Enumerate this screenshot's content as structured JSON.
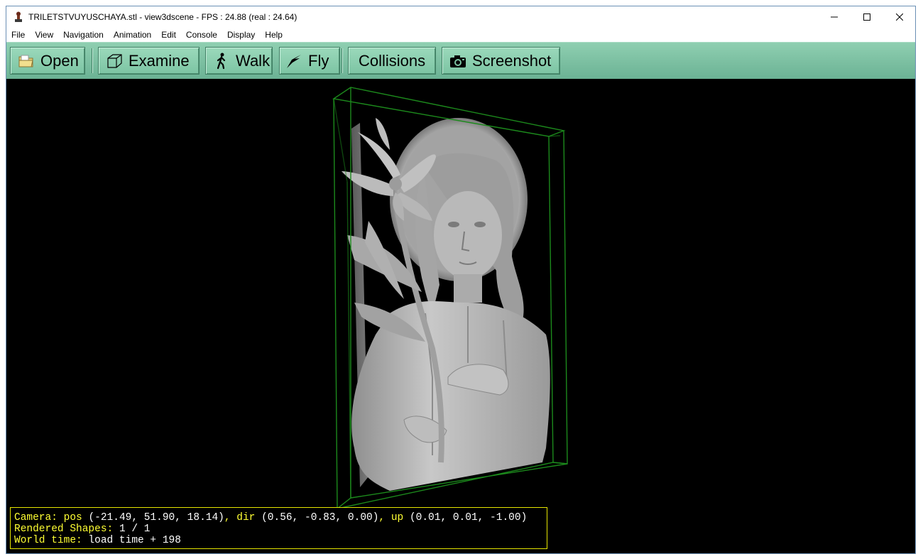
{
  "window": {
    "title": "TRILETSTVUYUSCHAYA.stl - view3dscene - FPS : 24.88 (real : 24.64)",
    "controls": {
      "minimize": "—",
      "maximize": "☐",
      "close": "✕"
    }
  },
  "menu": {
    "items": [
      "File",
      "View",
      "Navigation",
      "Animation",
      "Edit",
      "Console",
      "Display",
      "Help"
    ]
  },
  "toolbar": {
    "open": "Open",
    "examine": "Examine",
    "walk": "Walk",
    "fly": "Fly",
    "collisions": "Collisions",
    "screenshot": "Screenshot"
  },
  "status": {
    "camera_label": "Camera:",
    "pos_label": "pos",
    "pos_value": "(-21.49, 51.90, 18.14)",
    "dir_label": "dir",
    "dir_value": "(0.56, -0.83, 0.00)",
    "up_label": "up",
    "up_value": "(0.01, 0.01, -1.00)",
    "shapes_label": "Rendered Shapes:",
    "shapes_value": "1 / 1",
    "time_label": "World time:",
    "time_value": "load time + 198"
  },
  "colors": {
    "toolbar": "#7cc4a3",
    "viewport": "#000000",
    "bbox": "#1a8a1a",
    "status_yellow": "#ffff33"
  },
  "icons": [
    "app-icon",
    "open-folder-icon",
    "cube-icon",
    "walk-icon",
    "fly-icon",
    "camera-icon"
  ]
}
